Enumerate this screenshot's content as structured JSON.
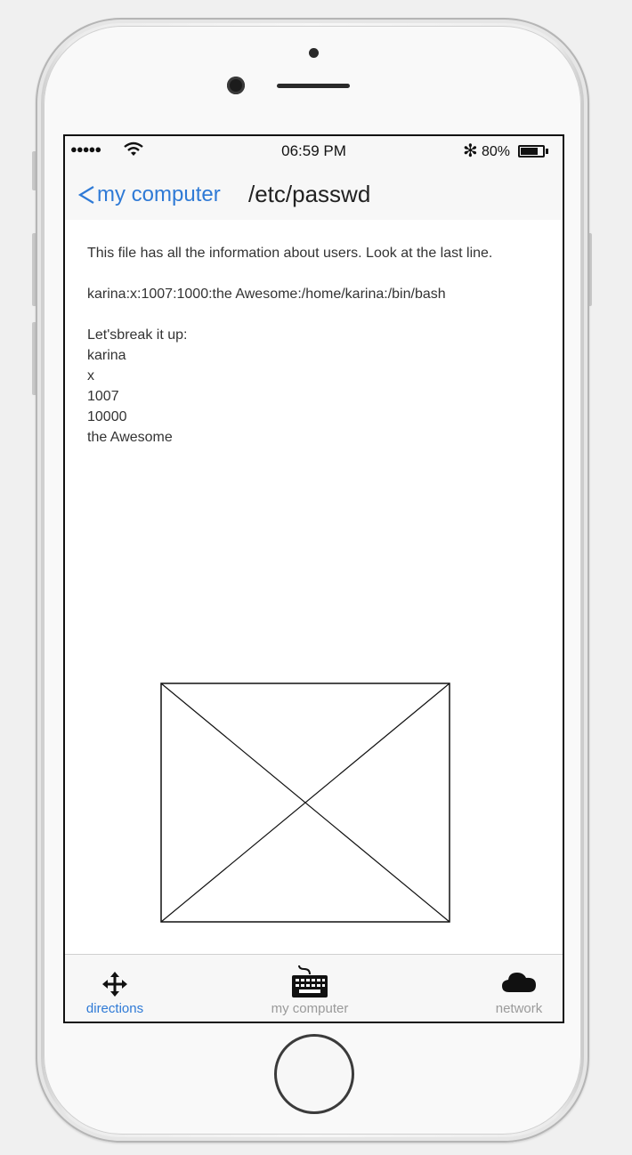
{
  "status_bar": {
    "signal": "●●●●●",
    "time": "06:59 PM",
    "bluetooth": "✻",
    "battery_percent_text": "80%",
    "battery_level": 0.8
  },
  "nav": {
    "back_label": "my computer",
    "title": "/etc/passwd"
  },
  "content": {
    "intro": "This file has all the information about users. Look at the last line.",
    "passwd_line": "karina:x:1007:1000:the Awesome:/home/karina:/bin/bash",
    "breakdown_heading": "Let'sbreak it up:",
    "breakdown_items": [
      "karina",
      "x",
      "1007",
      "10000",
      "the Awesome"
    ]
  },
  "tabs": [
    {
      "label": "directions",
      "icon": "move-arrows-icon",
      "active": true
    },
    {
      "label": "my computer",
      "icon": "keyboard-icon",
      "active": false
    },
    {
      "label": "network",
      "icon": "cloud-icon",
      "active": false
    }
  ],
  "colors": {
    "accent": "#2f7ad6",
    "inactive": "#9a9a9a",
    "bar_bg": "#f7f7f7"
  }
}
